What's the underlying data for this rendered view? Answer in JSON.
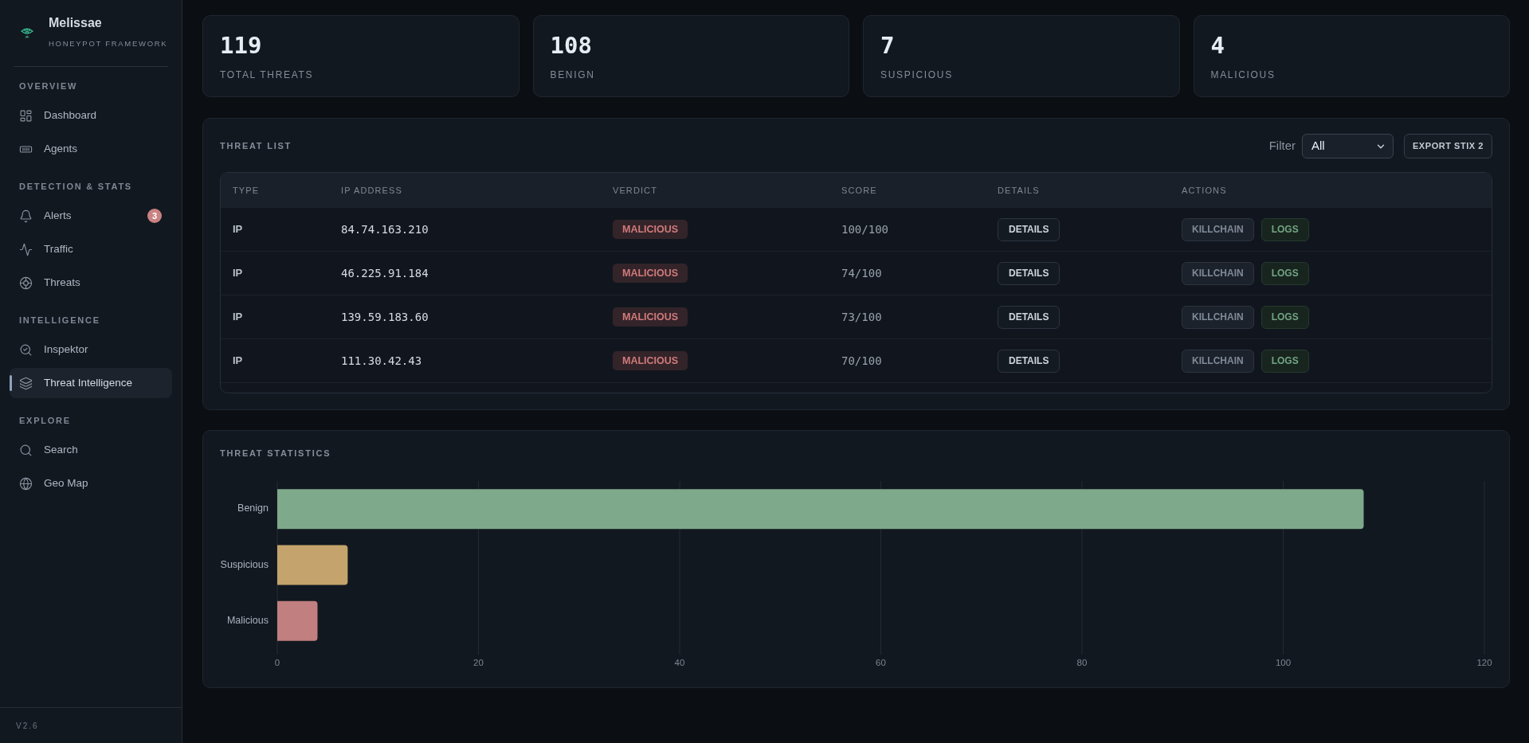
{
  "sidebar": {
    "brand": {
      "title": "Melissae",
      "subtitle": "HONEYPOT FRAMEWORK"
    },
    "sections": [
      {
        "heading": "OVERVIEW",
        "items": [
          {
            "label": "Dashboard",
            "selected": false
          },
          {
            "label": "Agents",
            "selected": false
          }
        ]
      },
      {
        "heading": "DETECTION & STATS",
        "items": [
          {
            "label": "Alerts",
            "selected": false,
            "badge": "3"
          },
          {
            "label": "Traffic",
            "selected": false
          },
          {
            "label": "Threats",
            "selected": false
          }
        ]
      },
      {
        "heading": "INTELLIGENCE",
        "items": [
          {
            "label": "Inspektor",
            "selected": false
          },
          {
            "label": "Threat Intelligence",
            "selected": true
          }
        ]
      },
      {
        "heading": "EXPLORE",
        "items": [
          {
            "label": "Search",
            "selected": false
          },
          {
            "label": "Geo Map",
            "selected": false
          }
        ]
      }
    ],
    "version": "V2.6"
  },
  "stats": [
    {
      "value": "119",
      "label": "TOTAL THREATS"
    },
    {
      "value": "108",
      "label": "BENIGN"
    },
    {
      "value": "7",
      "label": "SUSPICIOUS"
    },
    {
      "value": "4",
      "label": "MALICIOUS"
    }
  ],
  "threat_list": {
    "title": "THREAT LIST",
    "filter": {
      "label": "Filter",
      "value": "All"
    },
    "export_button": "EXPORT STIX 2",
    "columns": [
      "TYPE",
      "IP ADDRESS",
      "VERDICT",
      "SCORE",
      "DETAILS",
      "ACTIONS"
    ],
    "rows": [
      {
        "type": "IP",
        "ip_address": "84.74.163.210",
        "verdict": "MALICIOUS",
        "score": "100/100",
        "details_button": "DETAILS",
        "actions": [
          {
            "label": "KILLCHAIN",
            "kind": "neutral"
          },
          {
            "label": "LOGS",
            "kind": "positive"
          }
        ]
      },
      {
        "type": "IP",
        "ip_address": "46.225.91.184",
        "verdict": "MALICIOUS",
        "score": "74/100",
        "details_button": "DETAILS",
        "actions": [
          {
            "label": "KILLCHAIN",
            "kind": "neutral"
          },
          {
            "label": "LOGS",
            "kind": "positive"
          }
        ]
      },
      {
        "type": "IP",
        "ip_address": "139.59.183.60",
        "verdict": "MALICIOUS",
        "score": "73/100",
        "details_button": "DETAILS",
        "actions": [
          {
            "label": "KILLCHAIN",
            "kind": "neutral"
          },
          {
            "label": "LOGS",
            "kind": "positive"
          }
        ]
      },
      {
        "type": "IP",
        "ip_address": "111.30.42.43",
        "verdict": "MALICIOUS",
        "score": "70/100",
        "details_button": "DETAILS",
        "actions": [
          {
            "label": "KILLCHAIN",
            "kind": "neutral"
          },
          {
            "label": "LOGS",
            "kind": "positive"
          }
        ]
      }
    ]
  },
  "threat_statistics": {
    "title": "THREAT STATISTICS",
    "chart_data": {
      "type": "bar",
      "orientation": "horizontal",
      "stacked": true,
      "grid": true,
      "categories": [
        "Benign",
        "Suspicious",
        "Malicious"
      ],
      "series": [
        {
          "color": "#7ea98a",
          "values": [
            108,
            null,
            null
          ]
        },
        {
          "color": "#c4a46c",
          "values": [
            null,
            7,
            null
          ]
        },
        {
          "color": "#c17f7f",
          "values": [
            null,
            null,
            4
          ]
        }
      ],
      "xlim": [
        0,
        120
      ],
      "xticks": [
        0,
        20,
        40,
        60,
        80,
        100,
        120
      ]
    }
  }
}
